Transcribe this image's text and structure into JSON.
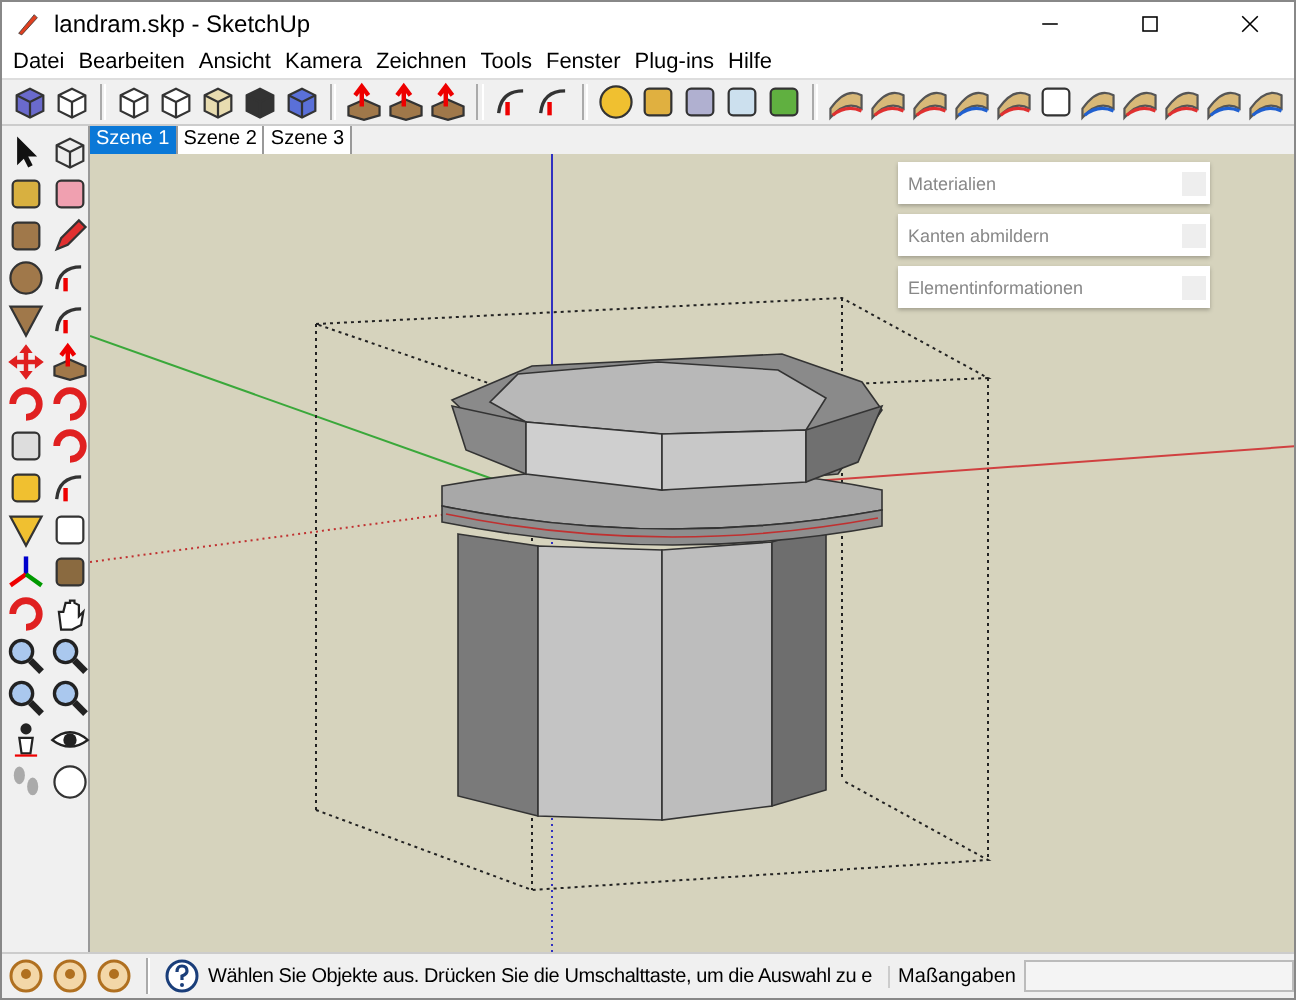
{
  "window": {
    "title": "landram.skp - SketchUp"
  },
  "menu": [
    "Datei",
    "Bearbeiten",
    "Ansicht",
    "Kamera",
    "Zeichnen",
    "Tools",
    "Fenster",
    "Plug-ins",
    "Hilfe"
  ],
  "scene_tabs": [
    {
      "label": "Szene 1",
      "selected": true
    },
    {
      "label": "Szene 2",
      "selected": false
    },
    {
      "label": "Szene 3",
      "selected": false
    }
  ],
  "trays": [
    {
      "title": "Materialien"
    },
    {
      "title": "Kanten abmildern"
    },
    {
      "title": "Elementinformationen"
    }
  ],
  "status_bar": {
    "message": "Wählen Sie Objekte aus. Drücken Sie die Umschalttaste, um die Auswahl zu e",
    "measurement_label": "Maßangaben"
  }
}
